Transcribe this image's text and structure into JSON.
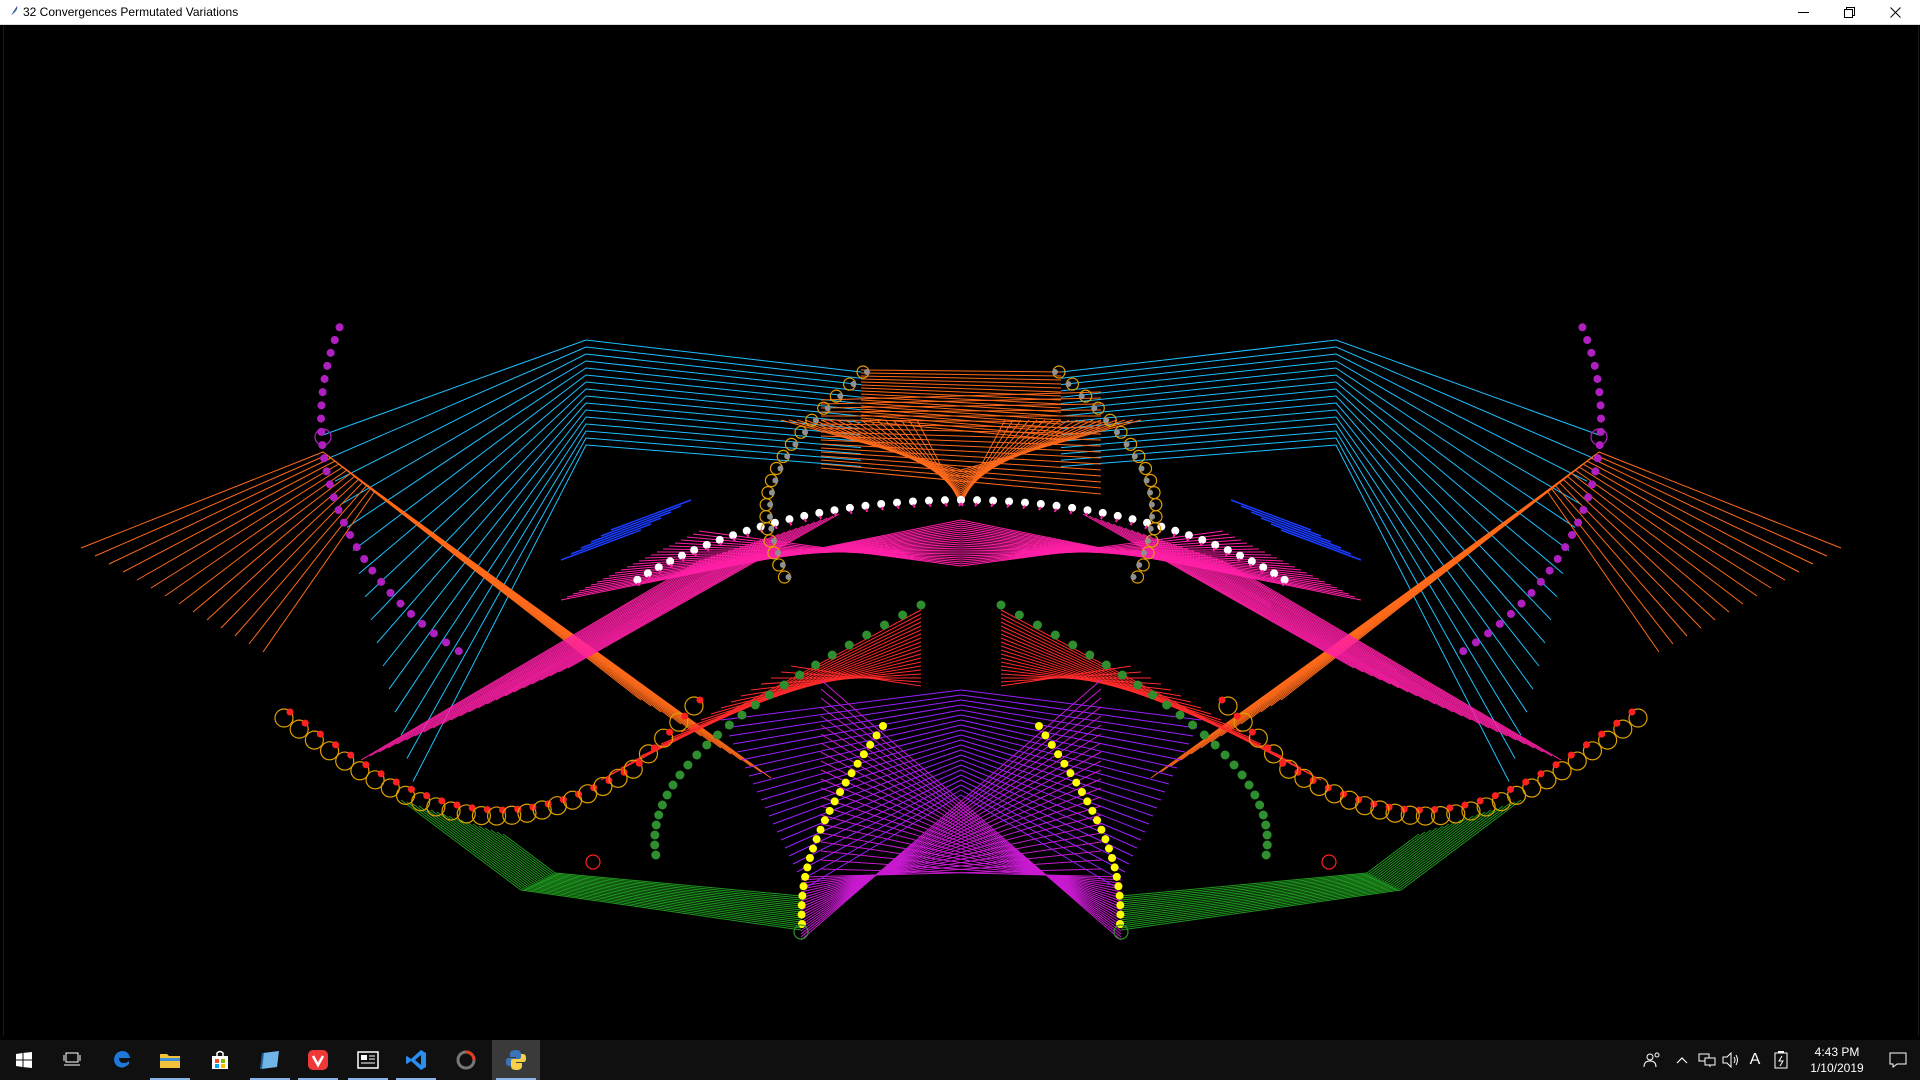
{
  "window": {
    "title": "32 Convergences Permutated Variations",
    "controls": [
      "minimize",
      "restore",
      "close"
    ]
  },
  "canvas": {
    "background": "#000000",
    "line_colors": [
      "#1ec0ff",
      "#ff6a1a",
      "#ff1fa6",
      "#c81ad0",
      "#1f9a1f",
      "#ff2a2a",
      "#9b1fff",
      "#1a3cff"
    ],
    "marker_colors": [
      "#b020c0",
      "#e0a000",
      "#ffffff",
      "#ff2020",
      "#2f8f2f",
      "#ffff00",
      "#909090"
    ]
  },
  "taskbar": {
    "apps": [
      {
        "name": "start-button",
        "icon": "windows-icon"
      },
      {
        "name": "task-view-button",
        "icon": "task-view-icon"
      },
      {
        "name": "edge-button",
        "icon": "edge-icon"
      },
      {
        "name": "file-explorer-button",
        "icon": "folder-icon"
      },
      {
        "name": "store-button",
        "icon": "store-icon"
      },
      {
        "name": "app-button",
        "icon": "notebook-icon"
      },
      {
        "name": "vivaldi-button",
        "icon": "vivaldi-icon"
      },
      {
        "name": "news-button",
        "icon": "news-icon"
      },
      {
        "name": "vscode-button",
        "icon": "vscode-icon"
      },
      {
        "name": "app-circle-button",
        "icon": "circle-app-icon"
      },
      {
        "name": "python-button",
        "icon": "python-icon"
      }
    ],
    "tray_icons": [
      "people-icon",
      "chevron-up-icon",
      "network-icon",
      "volume-icon",
      "input-indicator-icon",
      "battery-icon"
    ],
    "input_indicator": "A",
    "time": "4:43 PM",
    "date": "1/10/2019",
    "notifications_icon": "action-center-icon"
  }
}
